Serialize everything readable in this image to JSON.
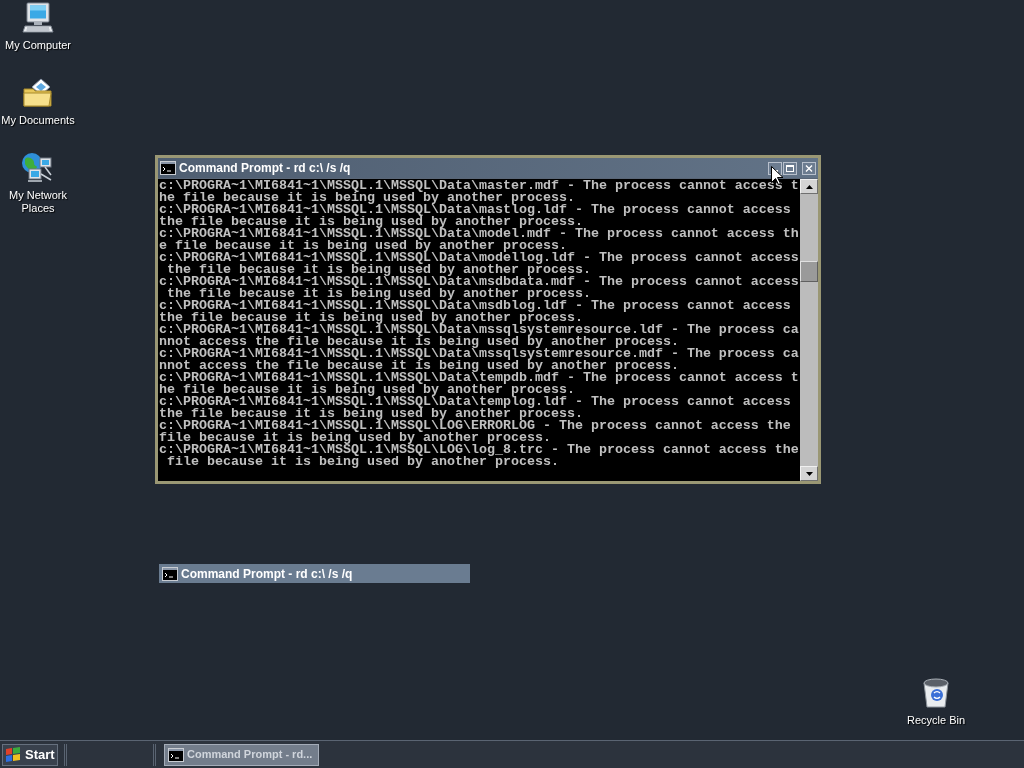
{
  "desktop_icons": [
    {
      "kind": "computer",
      "label": "My Computer"
    },
    {
      "kind": "documents",
      "label": "My Documents"
    },
    {
      "kind": "network",
      "label": "My Network Places"
    }
  ],
  "recycle_bin": {
    "kind": "recycle-bin",
    "label": "Recycle Bin"
  },
  "console_window": {
    "title": "Command Prompt - rd c:\\ /s /q",
    "lines": [
      "c:\\PROGRA~1\\MI6841~1\\MSSQL.1\\MSSQL\\Data\\master.mdf - The process cannot access t",
      "he file because it is being used by another process.",
      "c:\\PROGRA~1\\MI6841~1\\MSSQL.1\\MSSQL\\Data\\mastlog.ldf - The process cannot access",
      "the file because it is being used by another process.",
      "c:\\PROGRA~1\\MI6841~1\\MSSQL.1\\MSSQL\\Data\\model.mdf - The process cannot access th",
      "e file because it is being used by another process.",
      "c:\\PROGRA~1\\MI6841~1\\MSSQL.1\\MSSQL\\Data\\modellog.ldf - The process cannot access",
      " the file because it is being used by another process.",
      "c:\\PROGRA~1\\MI6841~1\\MSSQL.1\\MSSQL\\Data\\msdbdata.mdf - The process cannot access",
      " the file because it is being used by another process.",
      "c:\\PROGRA~1\\MI6841~1\\MSSQL.1\\MSSQL\\Data\\msdblog.ldf - The process cannot access",
      "the file because it is being used by another process.",
      "c:\\PROGRA~1\\MI6841~1\\MSSQL.1\\MSSQL\\Data\\mssqlsystemresource.ldf - The process ca",
      "nnot access the file because it is being used by another process.",
      "c:\\PROGRA~1\\MI6841~1\\MSSQL.1\\MSSQL\\Data\\mssqlsystemresource.mdf - The process ca",
      "nnot access the file because it is being used by another process.",
      "c:\\PROGRA~1\\MI6841~1\\MSSQL.1\\MSSQL\\Data\\tempdb.mdf - The process cannot access t",
      "he file because it is being used by another process.",
      "c:\\PROGRA~1\\MI6841~1\\MSSQL.1\\MSSQL\\Data\\templog.ldf - The process cannot access",
      "the file because it is being used by another process.",
      "c:\\PROGRA~1\\MI6841~1\\MSSQL.1\\MSSQL\\LOG\\ERRORLOG - The process cannot access the",
      "file because it is being used by another process.",
      "c:\\PROGRA~1\\MI6841~1\\MSSQL.1\\MSSQL\\LOG\\log_8.trc - The process cannot access the",
      " file because it is being used by another process."
    ]
  },
  "minimized_window": {
    "title": "Command Prompt - rd c:\\ /s /q"
  },
  "taskbar": {
    "start": "Start",
    "buttons": [
      {
        "label": "Command Prompt - rd..."
      }
    ]
  }
}
